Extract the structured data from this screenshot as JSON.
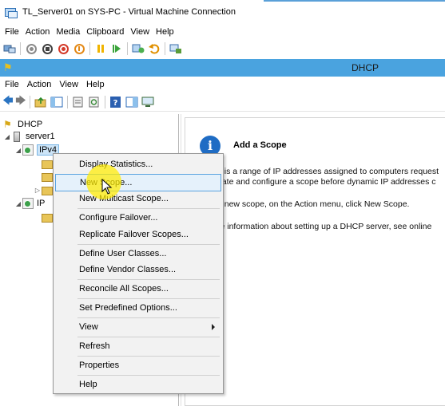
{
  "vm_window": {
    "title": "TL_Server01 on SYS-PC - Virtual Machine Connection",
    "menu": [
      "File",
      "Action",
      "Media",
      "Clipboard",
      "View",
      "Help"
    ],
    "toolbar_icons": [
      "ctrl-alt-del-icon",
      "start-icon",
      "turn-off-icon",
      "shutdown-icon",
      "power-icon",
      "pause-icon",
      "resume-icon",
      "checkpoint-icon",
      "revert-icon",
      "enhanced-session-icon"
    ]
  },
  "guest_window": {
    "title": "DHCP",
    "menu": [
      "File",
      "Action",
      "View",
      "Help"
    ],
    "toolbar_icons": [
      "back-arrow-icon",
      "forward-arrow-icon",
      "up-folder-icon",
      "show-hide-tree-icon",
      "properties-icon",
      "refresh-icon",
      "help-icon",
      "export-icon",
      "console-icon"
    ]
  },
  "tree": {
    "root": "DHCP",
    "server": "server1",
    "ipv4": "IPv4",
    "ipv6_partial": "IP"
  },
  "content": {
    "heading": "Add a Scope",
    "line1": "e is a range of IP addresses assigned to computers request",
    "line2": "eate and configure a scope before dynamic IP addresses c",
    "line3": "a new scope, on the Action menu, click New Scope.",
    "line4": "re information about setting up a DHCP server, see online"
  },
  "context_menu": {
    "items": [
      "Display Statistics...",
      "New Scope...",
      "New Multicast Scope...",
      "Configure Failover...",
      "Replicate Failover Scopes...",
      "Define User Classes...",
      "Define Vendor Classes...",
      "Reconcile All Scopes...",
      "Set Predefined Options...",
      "View",
      "Refresh",
      "Properties",
      "Help"
    ],
    "highlighted": "New Scope..."
  },
  "colors": {
    "guest_titlebar": "#4aa3df",
    "menu_hover_border": "#5aa3e0",
    "cursor_highlight": "#ffec00"
  }
}
